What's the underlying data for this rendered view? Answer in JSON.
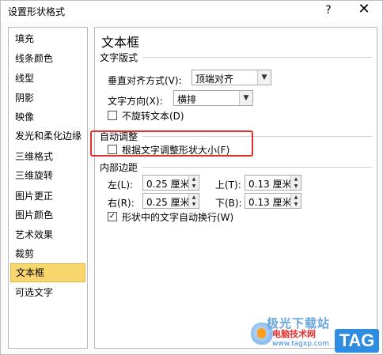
{
  "window": {
    "title": "设置形状格式",
    "help_label": "?",
    "close_label": "✕"
  },
  "sidebar": {
    "items": [
      {
        "label": "填充"
      },
      {
        "label": "线条颜色"
      },
      {
        "label": "线型"
      },
      {
        "label": "阴影"
      },
      {
        "label": "映像"
      },
      {
        "label": "发光和柔化边缘"
      },
      {
        "label": "三维格式"
      },
      {
        "label": "三维旋转"
      },
      {
        "label": "图片更正"
      },
      {
        "label": "图片颜色"
      },
      {
        "label": "艺术效果"
      },
      {
        "label": "裁剪"
      },
      {
        "label": "文本框",
        "selected": true
      },
      {
        "label": "可选文字"
      }
    ]
  },
  "pane": {
    "title": "文本框",
    "layout_section": {
      "label": "文字版式",
      "vertical_align_label": "垂直对齐方式(V):",
      "vertical_align_value": "顶端对齐",
      "text_direction_label": "文字方向(X):",
      "text_direction_value": "横排",
      "no_rotate_label": "不旋转文本(D)",
      "no_rotate_checked": false
    },
    "autofit_section": {
      "label": "自动调整",
      "resize_shape_label": "根据文字调整形状大小(F)",
      "resize_shape_checked": false
    },
    "margins_section": {
      "label": "内部边距",
      "left_label": "左(L):",
      "left_value": "0.25 厘米",
      "top_label": "上(T):",
      "top_value": "0.13 厘米",
      "right_label": "右(R):",
      "right_value": "0.25 厘米",
      "bottom_label": "下(B):",
      "bottom_value": "0.13 厘米",
      "wrap_label": "形状中的文字自动换行(W)",
      "wrap_checked": true
    }
  },
  "watermark": {
    "line1": "极光下载站",
    "line2": "电脑技术网",
    "url": "www.tagxp.com",
    "tag": "TAG"
  },
  "colors": {
    "selected_item_bg": "#f8d66e",
    "highlight_border": "#e0312d",
    "tag_bg": "#2f8de1"
  }
}
